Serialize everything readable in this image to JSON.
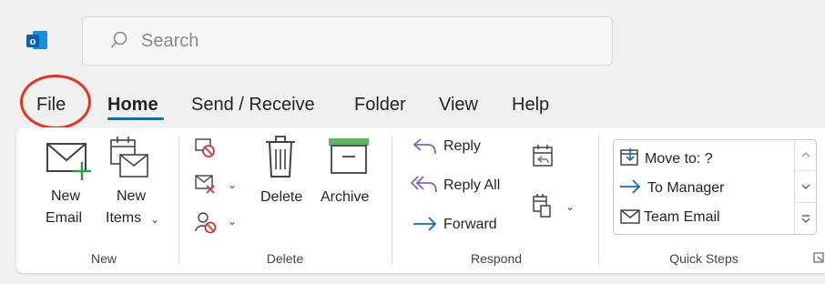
{
  "search": {
    "placeholder": "Search"
  },
  "tabs": [
    {
      "label": "File"
    },
    {
      "label": "Home"
    },
    {
      "label": "Send / Receive"
    },
    {
      "label": "Folder"
    },
    {
      "label": "View"
    },
    {
      "label": "Help"
    }
  ],
  "active_tab": "Home",
  "ribbon": {
    "new": {
      "group_label": "New",
      "new_email": {
        "line1": "New",
        "line2": "Email"
      },
      "new_items": {
        "line1": "New",
        "line2": "Items"
      }
    },
    "delete": {
      "group_label": "Delete",
      "delete_label": "Delete",
      "archive_label": "Archive"
    },
    "respond": {
      "group_label": "Respond",
      "reply": "Reply",
      "reply_all": "Reply All",
      "forward": "Forward"
    },
    "quick_steps": {
      "group_label": "Quick Steps",
      "items": [
        {
          "label": "Move to: ?"
        },
        {
          "label": "To Manager"
        },
        {
          "label": "Team Email"
        }
      ]
    }
  },
  "colors": {
    "accent": "#0f6cbd",
    "highlight": "#e8321e",
    "delete_red": "#d13438",
    "archive_green": "#5cb85c"
  }
}
